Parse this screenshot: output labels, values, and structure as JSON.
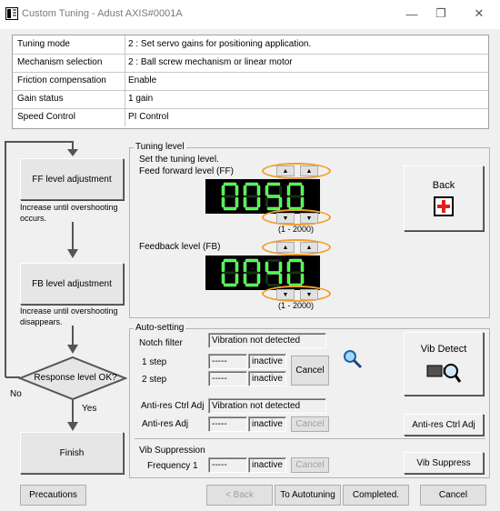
{
  "window": {
    "title": "Custom Tuning - Adust AXIS#0001A"
  },
  "info_rows": [
    {
      "label": "Tuning mode",
      "value": "2 : Set servo gains for positioning application."
    },
    {
      "label": "Mechanism selection",
      "value": "2 : Ball screw mechanism or linear motor"
    },
    {
      "label": "Friction compensation",
      "value": "Enable"
    },
    {
      "label": "Gain status",
      "value": "1 gain"
    },
    {
      "label": "Speed Control",
      "value": "PI Control"
    }
  ],
  "flow": {
    "ff_box": "FF level adjustment",
    "ff_note": "Increase until overshooting occurs.",
    "fb_box": "FB level adjustment",
    "fb_note": "Increase until overshooting disappears.",
    "decision": "Response level OK?",
    "no_label": "No",
    "yes_label": "Yes",
    "finish": "Finish"
  },
  "tuning_level": {
    "title": "Tuning level",
    "instruction": "Set the tuning level.",
    "ff_label": "Feed forward level (FF)",
    "ff_value": "0050",
    "ff_range": "(1 - 2000)",
    "fb_label": "Feedback level (FB)",
    "fb_value": "0040",
    "fb_range": "(1 - 2000)",
    "up_arrow": "▲",
    "down_arrow": "▼",
    "display_color": "#44ff44"
  },
  "back_button": {
    "label": "Back"
  },
  "auto_setting": {
    "title": "Auto-setting",
    "notch_label": "Notch filter",
    "notch_status": "Vibration not detected",
    "step1_label": "1 step",
    "step1_value": "-----",
    "step1_state": "inactive",
    "step2_label": "2 step",
    "step2_value": "-----",
    "step2_state": "inactive",
    "cancel_label": "Cancel",
    "antires_ctrl_label": "Anti-res Ctrl Adj",
    "antires_ctrl_status": "Vibration not detected",
    "antires_label": "Anti-res Adj",
    "antires_value": "-----",
    "antires_state": "inactive",
    "antires_cancel": "Cancel",
    "vib_detect_label": "Vib Detect",
    "antires_button": "Anti-res Ctrl Adj",
    "vib_supp_label": "Vib Suppression",
    "freq1_label": "Frequency 1",
    "freq1_value": "-----",
    "freq1_state": "inactive",
    "freq1_cancel": "Cancel",
    "vib_suppress_button": "Vib Suppress"
  },
  "footer": {
    "precautions": "Precautions",
    "back": "< Back",
    "to_autotuning": "To Autotuning",
    "completed": "Completed.",
    "cancel": "Cancel"
  }
}
